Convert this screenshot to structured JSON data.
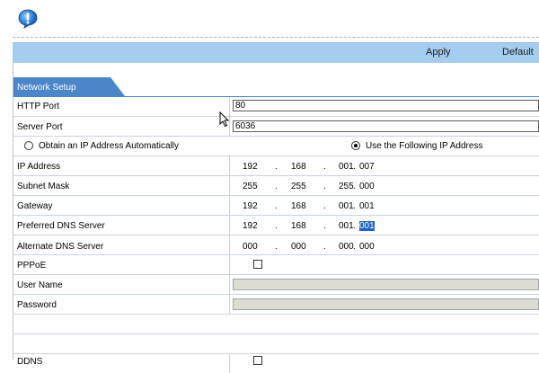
{
  "toolbar": {
    "apply_label": "Apply",
    "default_label": "Default"
  },
  "tab": {
    "label": "Network Setup"
  },
  "form": {
    "http_port": {
      "label": "HTTP Port",
      "value": "80"
    },
    "server_port": {
      "label": "Server Port",
      "value": "6036"
    },
    "ip_mode": {
      "auto_label": "Obtain an IP Address Automatically",
      "manual_label": "Use the Following IP Address",
      "selected": "manual"
    },
    "ip_address": {
      "label": "IP Address",
      "octets": [
        "192",
        "168",
        "001",
        "007"
      ]
    },
    "subnet_mask": {
      "label": "Subnet Mask",
      "octets": [
        "255",
        "255",
        "255",
        "000"
      ]
    },
    "gateway": {
      "label": "Gateway",
      "octets": [
        "192",
        "168",
        "001",
        "001"
      ]
    },
    "preferred_dns": {
      "label": "Preferred DNS Server",
      "octets": [
        "192",
        "168",
        "001",
        "001"
      ],
      "selected_octet": 4
    },
    "alternate_dns": {
      "label": "Alternate DNS Server",
      "octets": [
        "000",
        "000",
        "000",
        "000"
      ]
    },
    "pppoe": {
      "label": "PPPoE",
      "checked": false
    },
    "user_name": {
      "label": "User Name",
      "value": ""
    },
    "password": {
      "label": "Password",
      "value": ""
    },
    "ddns": {
      "label": "DDNS",
      "checked": false
    }
  },
  "colors": {
    "toolbar_bg": "#a4cdef",
    "tab_bg": "#4a86c8",
    "selection_bg": "#1c63c7",
    "disabled_field": "#dcdcd2"
  },
  "icons": {
    "header": "info-exclamation-icon",
    "cursor": "mouse-pointer-icon"
  }
}
